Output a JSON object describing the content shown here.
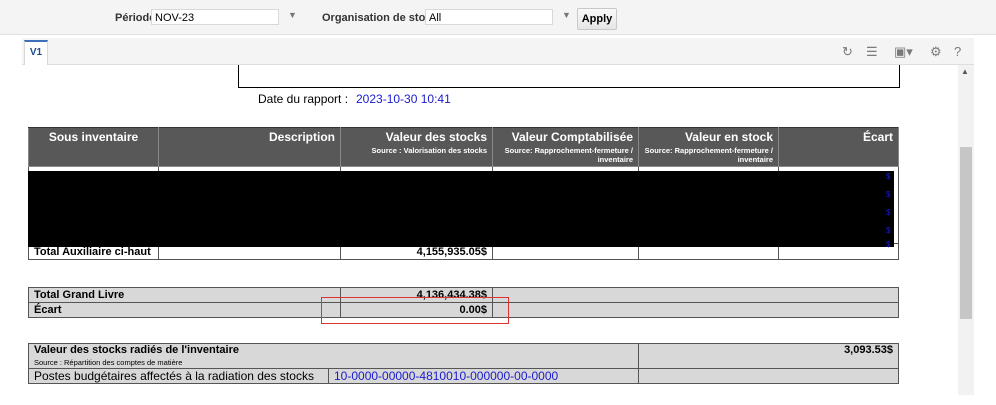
{
  "filters": {
    "period_label": "Période",
    "period_value": "NOV-23",
    "org_label": "Organisation de stock",
    "org_value": "All",
    "apply_label": "Apply"
  },
  "tabs": [
    {
      "label": "V1"
    }
  ],
  "toolbar_icons": [
    "refresh-icon",
    "list-icon",
    "export-icon",
    "gear-icon",
    "help-icon"
  ],
  "report": {
    "date_label": "Date du rapport :",
    "date_value": "2023-10-30 10:41",
    "headers": {
      "sous_inventaire": "Sous inventaire",
      "description": "Description",
      "valeur_stocks": "Valeur des stocks",
      "valeur_stocks_src": "Source : Valorisation des stocks",
      "valeur_compta": "Valeur Comptabilisée",
      "valeur_compta_src": "Source: Rapprochement-fermeture / inventaire",
      "valeur_en_stock": "Valeur en stock",
      "valeur_en_stock_src": "Source: Rapprochement-fermeture / inventaire",
      "ecart": "Écart"
    },
    "total_aux_label": "Total Auxiliaire ci-haut",
    "total_aux_value": "4,155,935.05$",
    "total_gl_label": "Total Grand Livre",
    "total_gl_value": "4,136,434.38$",
    "ecart_label": "Écart",
    "ecart_value": "0.00$",
    "radies_label": "Valeur des stocks radiés de l'inventaire",
    "radies_src": "Source : Répartition des comptes de matière",
    "radies_value": "3,093.53$",
    "postes_label": "Postes budgétaires affectés à la radiation des stocks",
    "postes_value": "10-0000-00000-4810010-000000-00-0000"
  },
  "colors": {
    "accent": "#1a1ad0",
    "header_bg": "#585858",
    "highlight": "#d33"
  }
}
